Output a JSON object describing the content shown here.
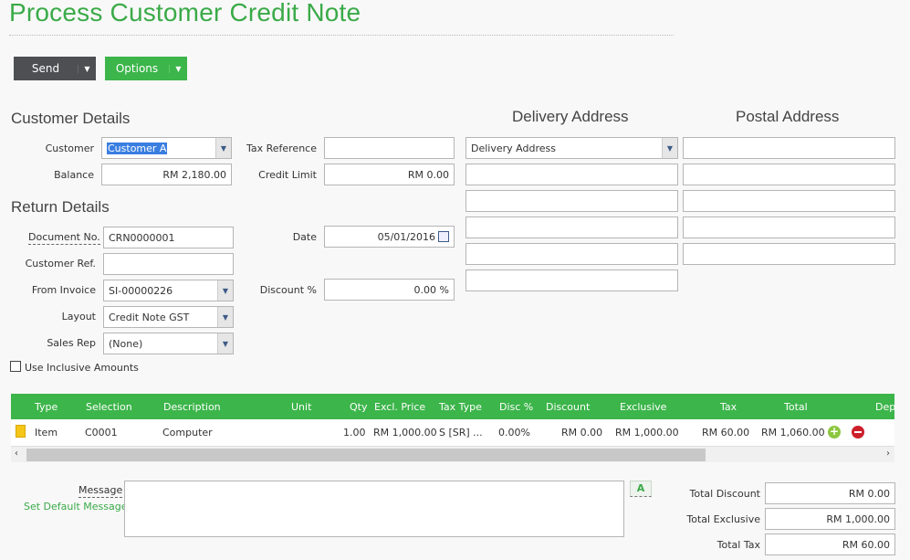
{
  "page": {
    "title": "Process Customer Credit Note"
  },
  "toolbar": {
    "send_label": "Send",
    "options_label": "Options"
  },
  "customer_details": {
    "heading": "Customer Details",
    "customer_label": "Customer",
    "customer_value": "Customer A",
    "balance_label": "Balance",
    "balance_value": "RM 2,180.00",
    "tax_ref_label": "Tax Reference",
    "tax_ref_value": "",
    "credit_limit_label": "Credit Limit",
    "credit_limit_value": "RM 0.00"
  },
  "return_details": {
    "heading": "Return Details",
    "doc_no_label": "Document No.",
    "doc_no_value": "CRN0000001",
    "cust_ref_label": "Customer Ref.",
    "cust_ref_value": "",
    "from_invoice_label": "From Invoice",
    "from_invoice_value": "SI-00000226",
    "layout_label": "Layout",
    "layout_value": "Credit Note GST",
    "sales_rep_label": "Sales Rep",
    "sales_rep_value": "(None)",
    "date_label": "Date",
    "date_value": "05/01/2016",
    "discount_label": "Discount %",
    "discount_value": "0.00 %",
    "inclusive_label": "Use Inclusive Amounts",
    "inclusive_checked": false
  },
  "delivery": {
    "heading": "Delivery Address",
    "select_value": "Delivery Address",
    "lines": [
      "",
      "",
      "",
      "",
      ""
    ]
  },
  "postal": {
    "heading": "Postal Address",
    "lines": [
      "",
      "",
      "",
      "",
      ""
    ]
  },
  "grid": {
    "columns": [
      "Type",
      "Selection",
      "Description",
      "Unit",
      "Qty",
      "Excl. Price",
      "Tax Type",
      "Disc %",
      "Discount",
      "Exclusive",
      "Tax",
      "Total",
      "Dep"
    ],
    "rows": [
      {
        "type": "Item",
        "selection": "C0001",
        "description": "Computer",
        "unit": "",
        "qty": "1.00",
        "excl_price": "RM 1,000.00",
        "tax_type": "S [SR] ...",
        "disc_pct": "0.00%",
        "discount": "RM 0.00",
        "exclusive": "RM 1,000.00",
        "tax": "RM 60.00",
        "total": "RM 1,060.00"
      }
    ]
  },
  "message": {
    "label": "Message",
    "set_default_label": "Set Default Message",
    "value": "",
    "spell_icon_text": "A"
  },
  "totals": {
    "discount_label": "Total Discount",
    "discount_value": "RM 0.00",
    "exclusive_label": "Total Exclusive",
    "exclusive_value": "RM 1,000.00",
    "tax_label": "Total Tax",
    "tax_value": "RM 60.00"
  },
  "colors": {
    "accent": "#3cb54a",
    "dark_button": "#4d4f52",
    "delete": "#cc1f2a"
  }
}
